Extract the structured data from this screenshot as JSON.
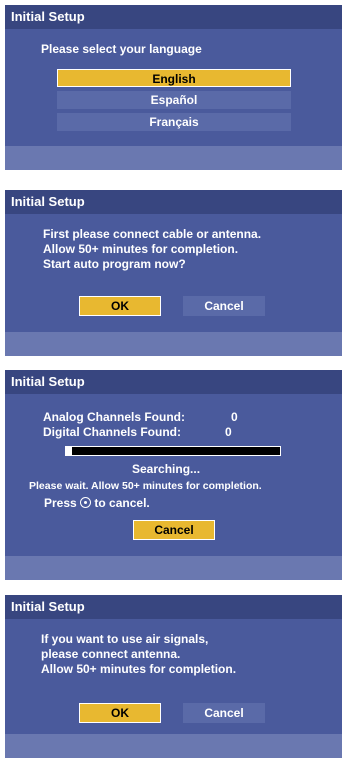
{
  "panel1": {
    "title": "Initial Setup",
    "prompt": "Please select your language",
    "languages": [
      "English",
      "Español",
      "Français"
    ],
    "selected_index": 0
  },
  "panel2": {
    "title": "Initial Setup",
    "lines": [
      "First please connect cable or antenna.",
      "Allow 50+ minutes for completion.",
      "Start auto program now?"
    ],
    "ok_label": "OK",
    "cancel_label": "Cancel"
  },
  "panel3": {
    "title": "Initial Setup",
    "analog_label": "Analog Channels Found:",
    "analog_count": "0",
    "digital_label": "Digital Channels Found:",
    "digital_count": "0",
    "progress_fraction": 0.03,
    "searching": "Searching...",
    "wait_note": "Please wait. Allow 50+ minutes for completion.",
    "press_label": "Press",
    "to_cancel_label": "to cancel.",
    "cancel_icon": "circle-button-icon",
    "cancel_label": "Cancel"
  },
  "panel4": {
    "title": "Initial Setup",
    "lines": [
      "If you want to use air signals,",
      "please connect antenna.",
      "Allow 50+ minutes for completion."
    ],
    "ok_label": "OK",
    "cancel_label": "Cancel"
  },
  "colors": {
    "panel_bg": "#4a5a9c",
    "title_bg": "#384680",
    "highlight": "#e8b830",
    "item_bg": "#5a6aa8"
  }
}
